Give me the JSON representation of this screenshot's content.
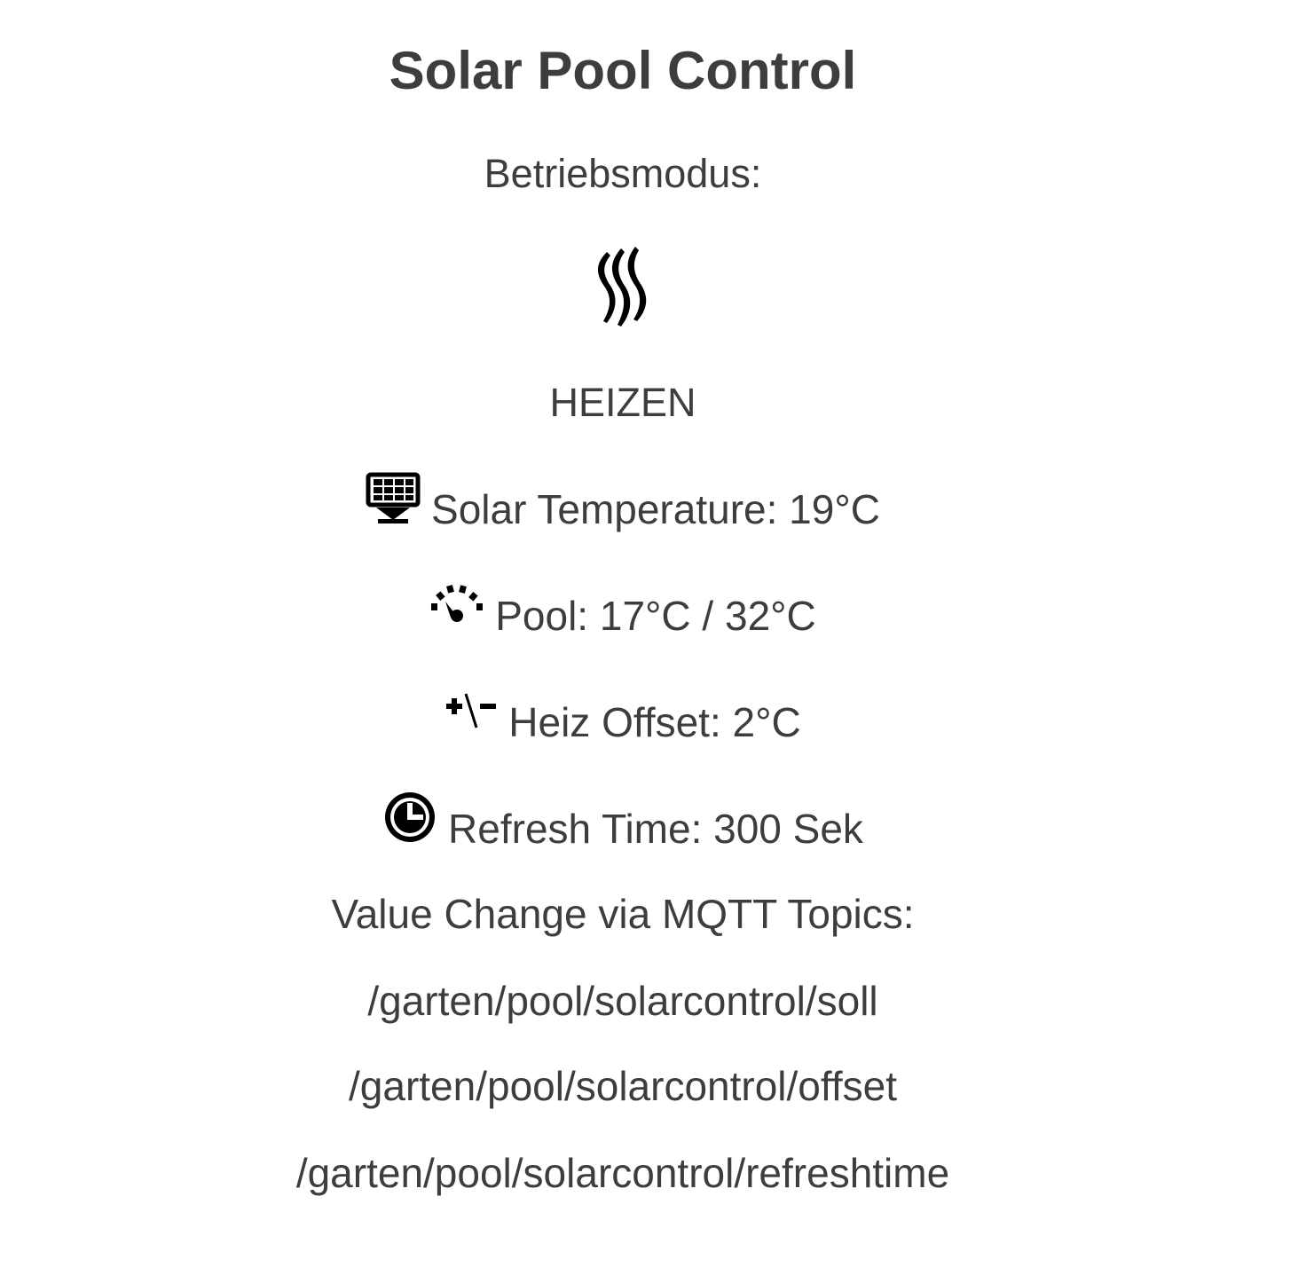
{
  "page": {
    "title": "Solar Pool Control"
  },
  "mode": {
    "label": "Betriebsmodus:",
    "icon": "heat-waves-icon",
    "value": "HEIZEN"
  },
  "status": {
    "solar": {
      "icon": "solar-panel-icon",
      "text": "Solar Temperature: 19°C"
    },
    "pool": {
      "icon": "gauge-icon",
      "text": "Pool: 17°C / 32°C"
    },
    "offset": {
      "icon": "plus-minus-icon",
      "text": "Heiz Offset: 2°C"
    },
    "refresh": {
      "icon": "clock-icon",
      "text": "Refresh Time: 300 Sek"
    }
  },
  "mqtt": {
    "heading": "Value Change via MQTT Topics:",
    "topics": [
      "/garten/pool/solarcontrol/soll",
      "/garten/pool/solarcontrol/offset",
      "/garten/pool/solarcontrol/refreshtime"
    ]
  },
  "colors": {
    "text": "#3d3d3d",
    "icon": "#000000",
    "background": "#ffffff"
  }
}
